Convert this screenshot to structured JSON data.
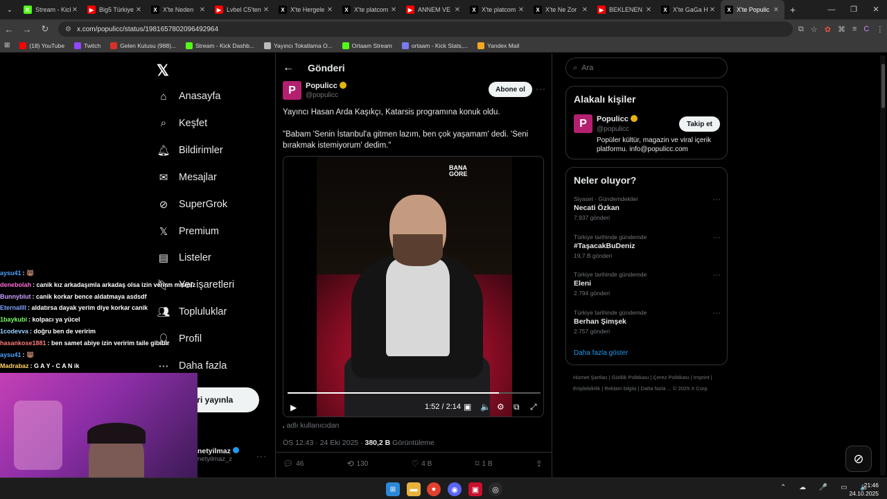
{
  "browser": {
    "tabs": [
      {
        "label": "Stream - Kick",
        "fav": "K",
        "color": "#53fc18"
      },
      {
        "label": "Big5 Türkiye",
        "fav": "▶",
        "color": "#ff0000"
      },
      {
        "label": "X'te Neden",
        "fav": "X",
        "color": "#000"
      },
      {
        "label": "Lvbel C5'ten",
        "fav": "▶",
        "color": "#ff0000"
      },
      {
        "label": "X'te Hergele",
        "fav": "X",
        "color": "#000"
      },
      {
        "label": "X'te platcom",
        "fav": "X",
        "color": "#000"
      },
      {
        "label": "ANNEM VE",
        "fav": "▶",
        "color": "#ff0000"
      },
      {
        "label": "X'te platcom",
        "fav": "X",
        "color": "#000"
      },
      {
        "label": "X'te Ne Zor",
        "fav": "X",
        "color": "#000"
      },
      {
        "label": "BEKLENEN D",
        "fav": "▶",
        "color": "#ff0000"
      },
      {
        "label": "X'te GaGa H",
        "fav": "X",
        "color": "#000"
      },
      {
        "label": "X'te Populic",
        "fav": "X",
        "color": "#000",
        "active": true
      }
    ],
    "url": "x.com/populicc/status/1981657802096492964",
    "bookmarks": [
      {
        "label": "(18) YouTube",
        "color": "#ff0000"
      },
      {
        "label": "Twitch",
        "color": "#9146ff"
      },
      {
        "label": "Gelen Kutusu (988)...",
        "color": "#d93025"
      },
      {
        "label": "Stream - Kick Dashb...",
        "color": "#53fc18"
      },
      {
        "label": "Yayıncı Tokatlama O...",
        "color": "#bbbbbb"
      },
      {
        "label": "Ortaam Stream",
        "color": "#53fc18"
      },
      {
        "label": "ortaam - Kick Stats,...",
        "color": "#7a7af0"
      },
      {
        "label": "Yandex Mail",
        "color": "#f5a623"
      }
    ]
  },
  "nav": {
    "items": [
      "Anasayfa",
      "Keşfet",
      "Bildirimler",
      "Mesajlar",
      "SuperGrok",
      "Premium",
      "Listeler",
      "Yer işaretleri",
      "Topluluklar",
      "Profil",
      "Daha fazla"
    ],
    "post_button": "eri yayınla",
    "account_name": "netyilmaz",
    "account_handle": "netyilmaz_z"
  },
  "post": {
    "header": "Gönderi",
    "author": "Populicc",
    "handle": "@populicc",
    "subscribe": "Abone ol",
    "text1": "Yayıncı Hasan Arda Kaşıkçı, Katarsis programına konuk oldu.",
    "text2": "\"Babam 'Senin İstanbul'a gitmen lazım, ben çok yaşamam' dedi. 'Seni bırakmak istemiyorum' dedim.\"",
    "brand": "BANA GÖRE",
    "video_time": "1:52 / 2:14",
    "progress": 0.836,
    "from_user": "adlı kullanıcıdan",
    "timestamp": "ÖS 12:43 · 24 Eki 2025 · ",
    "views": "380,2 B",
    "views_label": " Görüntüleme",
    "replies": "46",
    "reposts": "130",
    "likes": "4 B",
    "bookmarks": "1 B"
  },
  "sidebar": {
    "search_placeholder": "Ara",
    "related_title": "Alakalı kişiler",
    "related_name": "Populicc",
    "related_handle": "@populicc",
    "follow": "Takip et",
    "related_bio": "Popüler kültür, magazin ve viral içerik platformu. info@populicc.com",
    "trends_title": "Neler oluyor?",
    "trends": [
      {
        "cat": "Siyaset · Gündemdekiler",
        "name": "Necati Özkan",
        "posts": "7.937 gönderi"
      },
      {
        "cat": "Türkiye tarihinde gündemde",
        "name": "#TaşacakBuDeniz",
        "posts": "19,7 B gönderi"
      },
      {
        "cat": "Türkiye tarihinde gündemde",
        "name": "Eleni",
        "posts": "2.794 gönderi"
      },
      {
        "cat": "Türkiye tarihinde gündemde",
        "name": "Berhan Şimşek",
        "posts": "2.757 gönderi"
      }
    ],
    "show_more": "Daha fazla göster",
    "footer": "Hizmet Şartları  |  Gizlilik Politikası  |  Çerez Politikası  |  Imprint  |  Erişilebilirlik  |  Reklam bilgisi  |  Daha fazla ...  © 2025 X Corp."
  },
  "chat": [
    {
      "user": "aysu41",
      "msg": ": 🐻",
      "color": "#4da3ff"
    },
    {
      "user": "denebolah",
      "msg": ": canik kız arkadaşımla arkadaş olsa izin verirm misiniz",
      "color": "#ff6ad5"
    },
    {
      "user": "Bunnyblut",
      "msg": ": canik korkar bence aldatmaya asdsdf",
      "color": "#c7a0ff"
    },
    {
      "user": "Eternallll",
      "msg": ": aldatırsa dayak yerim diye korkar canik",
      "color": "#7fa3ff"
    },
    {
      "user": "1baykubi",
      "msg": ": kolpacı ya yücel",
      "color": "#7cff66"
    },
    {
      "user": "1codevva",
      "msg": ": doğru ben de veririm",
      "color": "#9ad1ff"
    },
    {
      "user": "hasankose1881",
      "msg": ": ben samet abiye izin veririm taile gibibir",
      "color": "#ff7a7a"
    },
    {
      "user": "aysu41",
      "msg": ": 🐻",
      "color": "#4da3ff"
    },
    {
      "user": "Madrabaz",
      "msg": ": G A Y - C A N ik",
      "color": "#ffd166"
    }
  ],
  "taskbar": {
    "time": "21:46",
    "date": "24.10.2025"
  }
}
